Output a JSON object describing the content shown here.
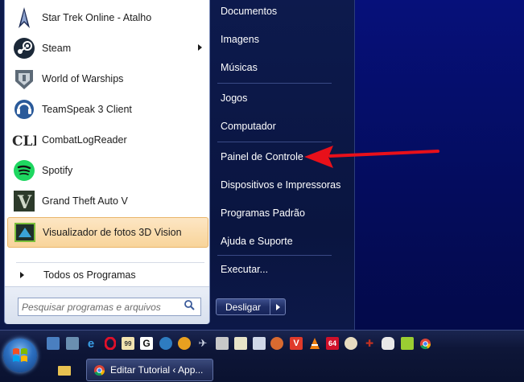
{
  "start_menu": {
    "programs": [
      {
        "label": "Star Trek Online - Atalho",
        "icon": "star-trek-icon",
        "has_submenu": false
      },
      {
        "label": "Steam",
        "icon": "steam-icon",
        "has_submenu": true
      },
      {
        "label": "World of Warships",
        "icon": "warships-icon",
        "has_submenu": false
      },
      {
        "label": "TeamSpeak 3 Client",
        "icon": "teamspeak-icon",
        "has_submenu": false
      },
      {
        "label": "CombatLogReader",
        "icon": "combatlog-icon",
        "has_submenu": false
      },
      {
        "label": "Spotify",
        "icon": "spotify-icon",
        "has_submenu": false
      },
      {
        "label": "Grand Theft Auto V",
        "icon": "gta-icon",
        "has_submenu": false
      },
      {
        "label": "Visualizador de fotos 3D Vision",
        "icon": "3d-vision-icon",
        "has_submenu": false,
        "highlighted": true
      }
    ],
    "all_programs_label": "Todos os Programas",
    "search_placeholder": "Pesquisar programas e arquivos",
    "right_items": [
      "Documentos",
      "Imagens",
      "Músicas",
      "Jogos",
      "Computador",
      "Painel de Controle",
      "Dispositivos e Impressoras",
      "Programas Padrão",
      "Ajuda e Suporte",
      "Executar..."
    ],
    "shutdown_label": "Desligar"
  },
  "taskbar": {
    "quick_launch_icons": [
      "desktop-icon",
      "network-icon",
      "ie-icon",
      "opera-icon",
      "badge-icon",
      "g-icon",
      "globe-icon",
      "finder-icon",
      "airplane-icon",
      "notes-icon",
      "calendar-icon",
      "ball-icon",
      "cube-icon",
      "vivaldi-icon",
      "vlc-icon",
      "64-icon",
      "paint-icon",
      "tool-icon",
      "mouse-icon",
      "puzzle-icon",
      "chrome-icon"
    ],
    "task_button_label": "Editar Tutorial ‹ App...",
    "badge_text": "99",
    "g_text": "G",
    "num_text": "64"
  },
  "colors": {
    "highlight": "#f8d49a",
    "annotation_arrow": "#e8101a",
    "desktop": "#06107a"
  }
}
